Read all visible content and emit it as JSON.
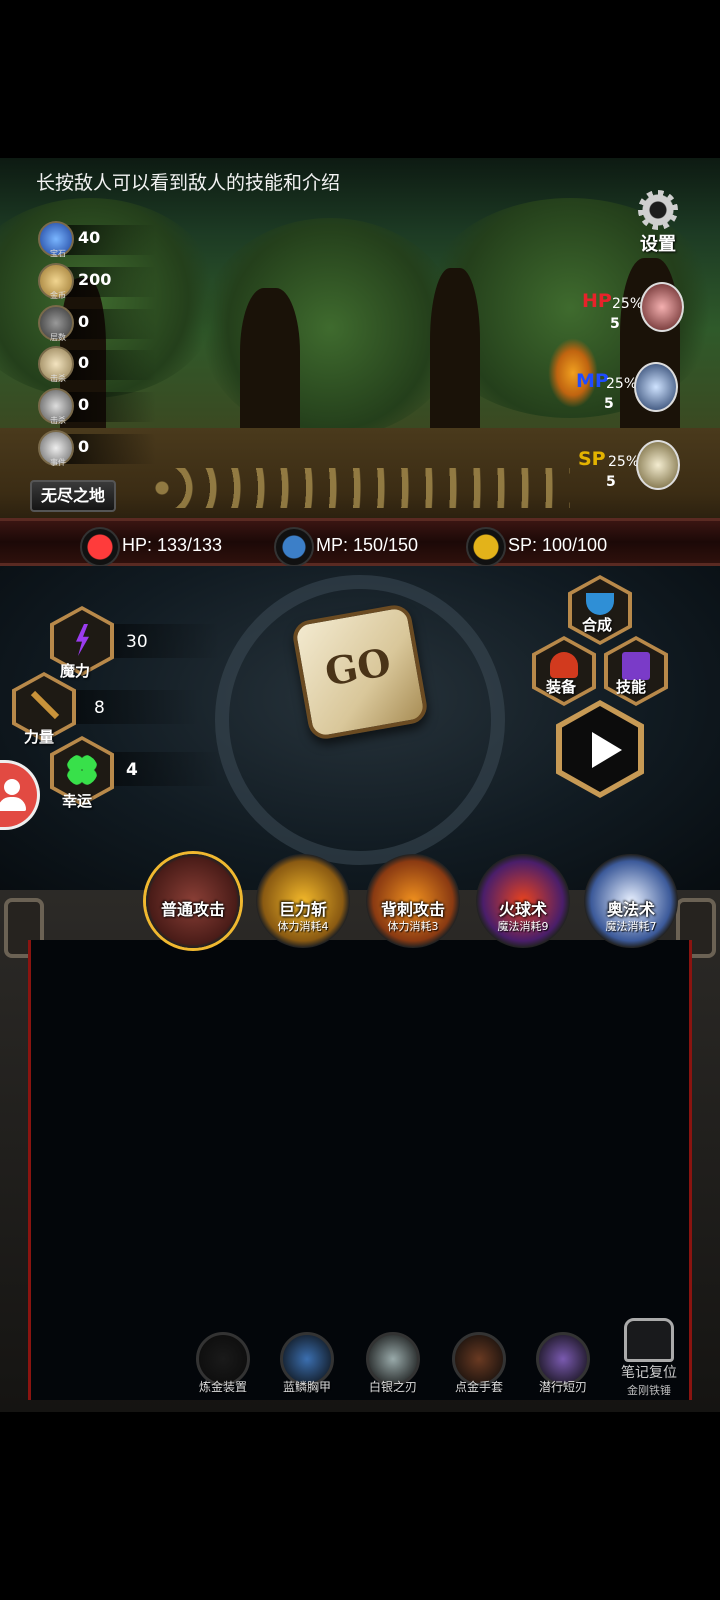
{
  "tip": "长按敌人可以看到敌人的技能和介绍",
  "settings": {
    "label": "设置"
  },
  "resources": [
    {
      "icon": "gem-icon",
      "sub": "宝石",
      "value": "40"
    },
    {
      "icon": "gold-coin-icon",
      "sub": "金币",
      "value": "200"
    },
    {
      "icon": "stone-icon",
      "sub": "层数",
      "value": "0"
    },
    {
      "icon": "face-icon",
      "sub": "击杀",
      "value": "0"
    },
    {
      "icon": "skull-icon",
      "sub": "击杀",
      "value": "0"
    },
    {
      "icon": "mask-icon",
      "sub": "事件",
      "value": "0"
    }
  ],
  "zone": "无尽之地",
  "potions": [
    {
      "name": "HP",
      "color": "#e8222a",
      "pct": "25%",
      "count": "5",
      "icon": "hp-potion-icon"
    },
    {
      "name": "MP",
      "color": "#1f4cff",
      "pct": "25%",
      "count": "5",
      "icon": "mp-potion-icon"
    },
    {
      "name": "SP",
      "color": "#e3b300",
      "pct": "25%",
      "count": "5",
      "icon": "sp-potion-icon"
    }
  ],
  "stats": {
    "hp": "HP: 133/133",
    "mp": "MP: 150/150",
    "sp": "SP: 100/100"
  },
  "attributes": [
    {
      "label": "魔力",
      "value": "30",
      "icon": "lightning-icon"
    },
    {
      "label": "力量",
      "value": "8",
      "icon": "sword-icon"
    },
    {
      "label": "幸运",
      "value": "4",
      "icon": "clover-icon"
    }
  ],
  "dice": {
    "text": "GO"
  },
  "menu": {
    "craft": "合成",
    "equip": "装备",
    "skill": "技能"
  },
  "skills": [
    {
      "name": "普通攻击",
      "cost": ""
    },
    {
      "name": "巨力斩",
      "cost": "体力消耗4"
    },
    {
      "name": "背刺攻击",
      "cost": "体力消耗3"
    },
    {
      "name": "火球术",
      "cost": "魔法消耗9"
    },
    {
      "name": "奥法术",
      "cost": "魔法消耗7"
    }
  ],
  "equipment": [
    {
      "name": "炼金装置",
      "icon": "flask-icon"
    },
    {
      "name": "蓝鳞胸甲",
      "icon": "armor-icon"
    },
    {
      "name": "白银之刃",
      "icon": "blade-icon"
    },
    {
      "name": "点金手套",
      "icon": "glove-icon"
    },
    {
      "name": "潜行短刃",
      "icon": "dagger-icon"
    }
  ],
  "note_reset": {
    "label": "笔记复位",
    "sub": "金刚铁锤"
  }
}
